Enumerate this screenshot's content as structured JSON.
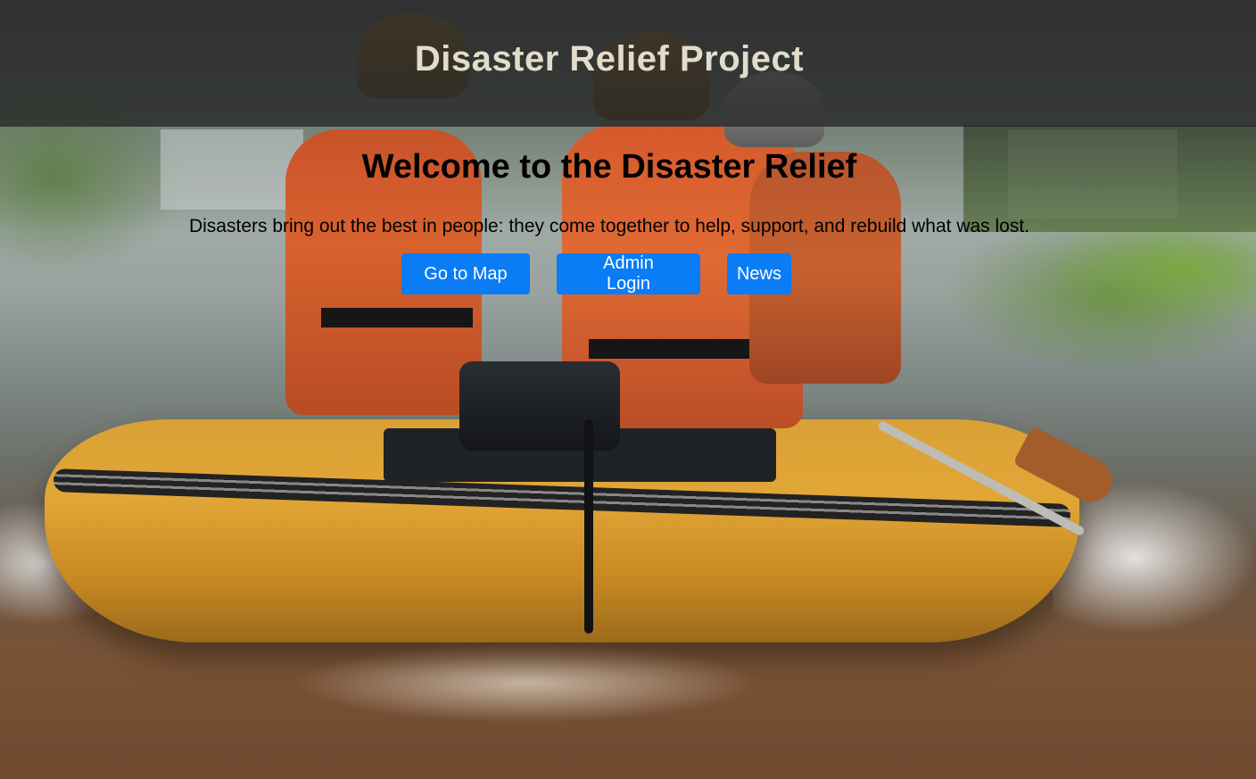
{
  "header": {
    "title": "Disaster Relief Project"
  },
  "main": {
    "heading": "Welcome to the Disaster Relief",
    "tagline": "Disasters bring out the best in people: they come together to help, support, and rebuild what was lost.",
    "buttons": [
      {
        "label": "Go to Map"
      },
      {
        "label": "Admin Login"
      },
      {
        "label": "News"
      }
    ]
  },
  "colors": {
    "button_background": "#0a7cf5",
    "button_text": "#ffffff",
    "header_overlay": "#262626",
    "title_text": "#e2dccb"
  },
  "background": {
    "icon": "rescue-boat-photo"
  }
}
